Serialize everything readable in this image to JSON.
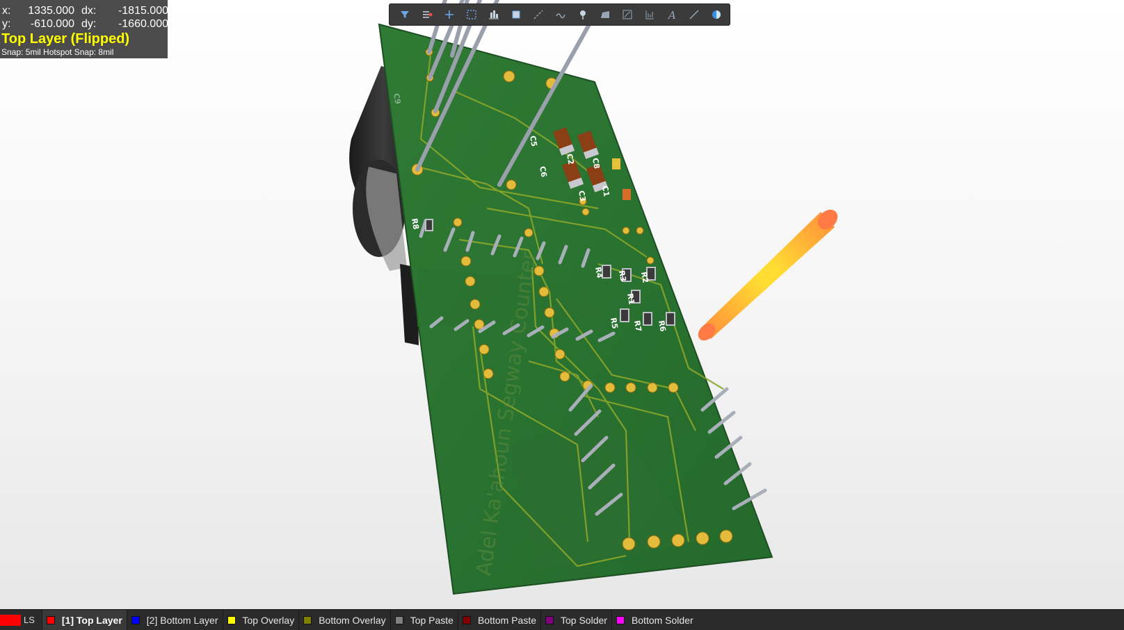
{
  "hud": {
    "x_label": "x:",
    "x_value": "1335.000",
    "dx_label": "dx:",
    "dx_value": "-1815.000",
    "y_label": "y:",
    "y_value": "-610.000",
    "dy_label": "dy:",
    "dy_value": "-1660.000",
    "unit": "mil",
    "layer_title": "Top Layer (Flipped)",
    "snap_text": "Snap: 5mil Hotspot Snap: 8mil"
  },
  "toolbar": {
    "buttons": [
      {
        "icon": "filter-icon"
      },
      {
        "icon": "route-icon"
      },
      {
        "icon": "crosshair-icon"
      },
      {
        "icon": "select-rect-icon"
      },
      {
        "icon": "align-icon"
      },
      {
        "icon": "component-icon"
      },
      {
        "icon": "interactive-routing-icon"
      },
      {
        "icon": "diff-pair-icon"
      },
      {
        "icon": "place-via-icon"
      },
      {
        "icon": "polygon-icon"
      },
      {
        "icon": "graph-icon"
      },
      {
        "icon": "dimension-icon"
      },
      {
        "icon": "text-icon"
      },
      {
        "icon": "line-icon"
      },
      {
        "icon": "3d-body-icon"
      }
    ]
  },
  "pcb": {
    "silkscreen_labels": [
      "C5",
      "C2",
      "C8",
      "C6",
      "C3",
      "C1",
      "R8",
      "R4",
      "R3",
      "R2",
      "R1",
      "R5",
      "R7",
      "R6",
      "C9"
    ],
    "board_text": "Adel Ka'ahoun Segway Counter"
  },
  "layerbar": {
    "ls_label": "LS",
    "layers": [
      {
        "label": "[1] Top Layer",
        "color": "#ff0000",
        "active": true
      },
      {
        "label": "[2] Bottom Layer",
        "color": "#0000ff",
        "active": false
      },
      {
        "label": "Top Overlay",
        "color": "#ffff00",
        "active": false
      },
      {
        "label": "Bottom Overlay",
        "color": "#808000",
        "active": false
      },
      {
        "label": "Top Paste",
        "color": "#808080",
        "active": false
      },
      {
        "label": "Bottom Paste",
        "color": "#800000",
        "active": false
      },
      {
        "label": "Top Solder",
        "color": "#800080",
        "active": false
      },
      {
        "label": "Bottom Solder",
        "color": "#ff00ff",
        "active": false
      }
    ]
  }
}
